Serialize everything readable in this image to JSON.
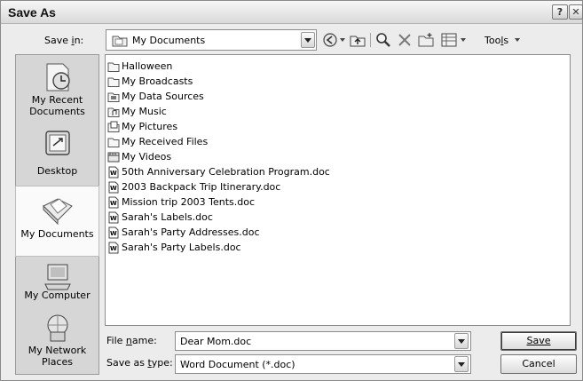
{
  "window": {
    "title": "Save As",
    "help_button": "?",
    "close_button": "✕"
  },
  "save_in": {
    "label": "Save in:",
    "value": "My Documents"
  },
  "toolbar": {
    "tools_label": "Tools"
  },
  "places": [
    {
      "label": "My Recent Documents",
      "icon": "recent-documents-icon"
    },
    {
      "label": "Desktop",
      "icon": "desktop-icon"
    },
    {
      "label": "My Documents",
      "icon": "my-documents-icon",
      "selected": true
    },
    {
      "label": "My Computer",
      "icon": "my-computer-icon"
    },
    {
      "label": "My Network Places",
      "icon": "network-places-icon"
    }
  ],
  "files": [
    {
      "name": "Halloween",
      "type": "folder"
    },
    {
      "name": "My Broadcasts",
      "type": "folder"
    },
    {
      "name": "My Data Sources",
      "type": "special-folder"
    },
    {
      "name": "My Music",
      "type": "special-folder"
    },
    {
      "name": "My Pictures",
      "type": "special-folder"
    },
    {
      "name": "My Received Files",
      "type": "folder"
    },
    {
      "name": "My Videos",
      "type": "special-folder"
    },
    {
      "name": "50th Anniversary Celebration Program.doc",
      "type": "doc"
    },
    {
      "name": "2003 Backpack Trip Itinerary.doc",
      "type": "doc"
    },
    {
      "name": "Mission trip 2003 Tents.doc",
      "type": "doc"
    },
    {
      "name": "Sarah's Labels.doc",
      "type": "doc"
    },
    {
      "name": "Sarah's Party Addresses.doc",
      "type": "doc"
    },
    {
      "name": "Sarah's Party Labels.doc",
      "type": "doc"
    }
  ],
  "file_name": {
    "label": "File name:",
    "value": "Dear Mom.doc"
  },
  "file_type": {
    "label": "Save as type:",
    "value": "Word Document (*.doc)"
  },
  "buttons": {
    "save": "Save",
    "cancel": "Cancel"
  }
}
